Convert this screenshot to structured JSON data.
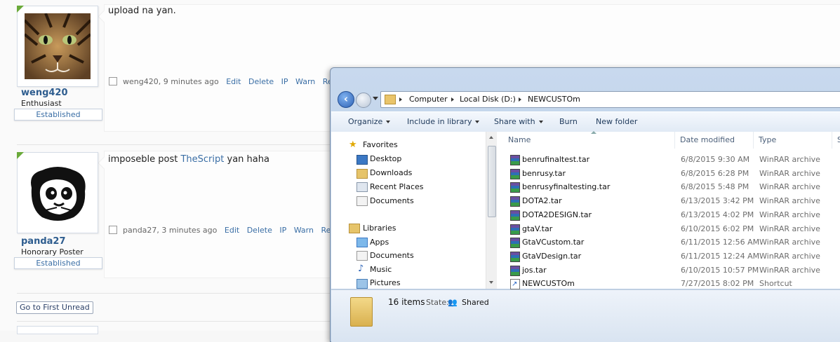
{
  "forum": {
    "posts": [
      {
        "text": "upload na yan.",
        "username": "weng420",
        "user_title": "Enthusiast",
        "badge": "Established",
        "meta_author": "weng420, 9 minutes ago",
        "actions": [
          "Edit",
          "Delete",
          "IP",
          "Warn",
          "Report"
        ]
      },
      {
        "text_before": "imposeble post",
        "text_link": "TheScript",
        "text_after": "yan haha",
        "username": "panda27",
        "user_title": "Honorary Poster",
        "badge": "Established",
        "meta_author": "panda27, 3 minutes ago",
        "actions": [
          "Edit",
          "Delete",
          "IP",
          "Warn",
          "Report"
        ]
      }
    ],
    "go_first_unread": "Go to First Unread"
  },
  "explorer": {
    "breadcrumb": [
      "Computer",
      "Local Disk (D:)",
      "NEWCUSTOm"
    ],
    "toolbar": [
      "Organize",
      "Include in library",
      "Share with",
      "Burn",
      "New folder"
    ],
    "nav": {
      "favorites_label": "Favorites",
      "favorites": [
        "Desktop",
        "Downloads",
        "Recent Places",
        "Documents"
      ],
      "libraries_label": "Libraries",
      "libraries": [
        "Apps",
        "Documents",
        "Music",
        "Pictures"
      ]
    },
    "columns": [
      "Name",
      "Date modified",
      "Type",
      "S"
    ],
    "files": [
      {
        "name": "benrufinaltest.tar",
        "date": "6/8/2015 9:30 AM",
        "type": "WinRAR archive",
        "icon": "rar-icon"
      },
      {
        "name": "benrusy.tar",
        "date": "6/8/2015 6:28 PM",
        "type": "WinRAR archive",
        "icon": "rar-icon"
      },
      {
        "name": "benrusyfinaltesting.tar",
        "date": "6/8/2015 5:48 PM",
        "type": "WinRAR archive",
        "icon": "rar-icon"
      },
      {
        "name": "DOTA2.tar",
        "date": "6/13/2015 3:42 PM",
        "type": "WinRAR archive",
        "icon": "rar-icon"
      },
      {
        "name": "DOTA2DESIGN.tar",
        "date": "6/13/2015 4:02 PM",
        "type": "WinRAR archive",
        "icon": "rar-icon"
      },
      {
        "name": "gtaV.tar",
        "date": "6/10/2015 6:02 PM",
        "type": "WinRAR archive",
        "icon": "rar-icon"
      },
      {
        "name": "GtaVCustom.tar",
        "date": "6/11/2015 12:56 AM",
        "type": "WinRAR archive",
        "icon": "rar-icon"
      },
      {
        "name": "GtaVDesign.tar",
        "date": "6/11/2015 12:24 AM",
        "type": "WinRAR archive",
        "icon": "rar-icon"
      },
      {
        "name": "jos.tar",
        "date": "6/10/2015 10:57 PM",
        "type": "WinRAR archive",
        "icon": "rar-icon"
      },
      {
        "name": "NEWCUSTOm",
        "date": "7/27/2015 8:02 PM",
        "type": "Shortcut",
        "icon": "shortcut-icon"
      }
    ],
    "details": {
      "count": "16 items",
      "state_label": "State:",
      "state_value": "Shared"
    }
  }
}
